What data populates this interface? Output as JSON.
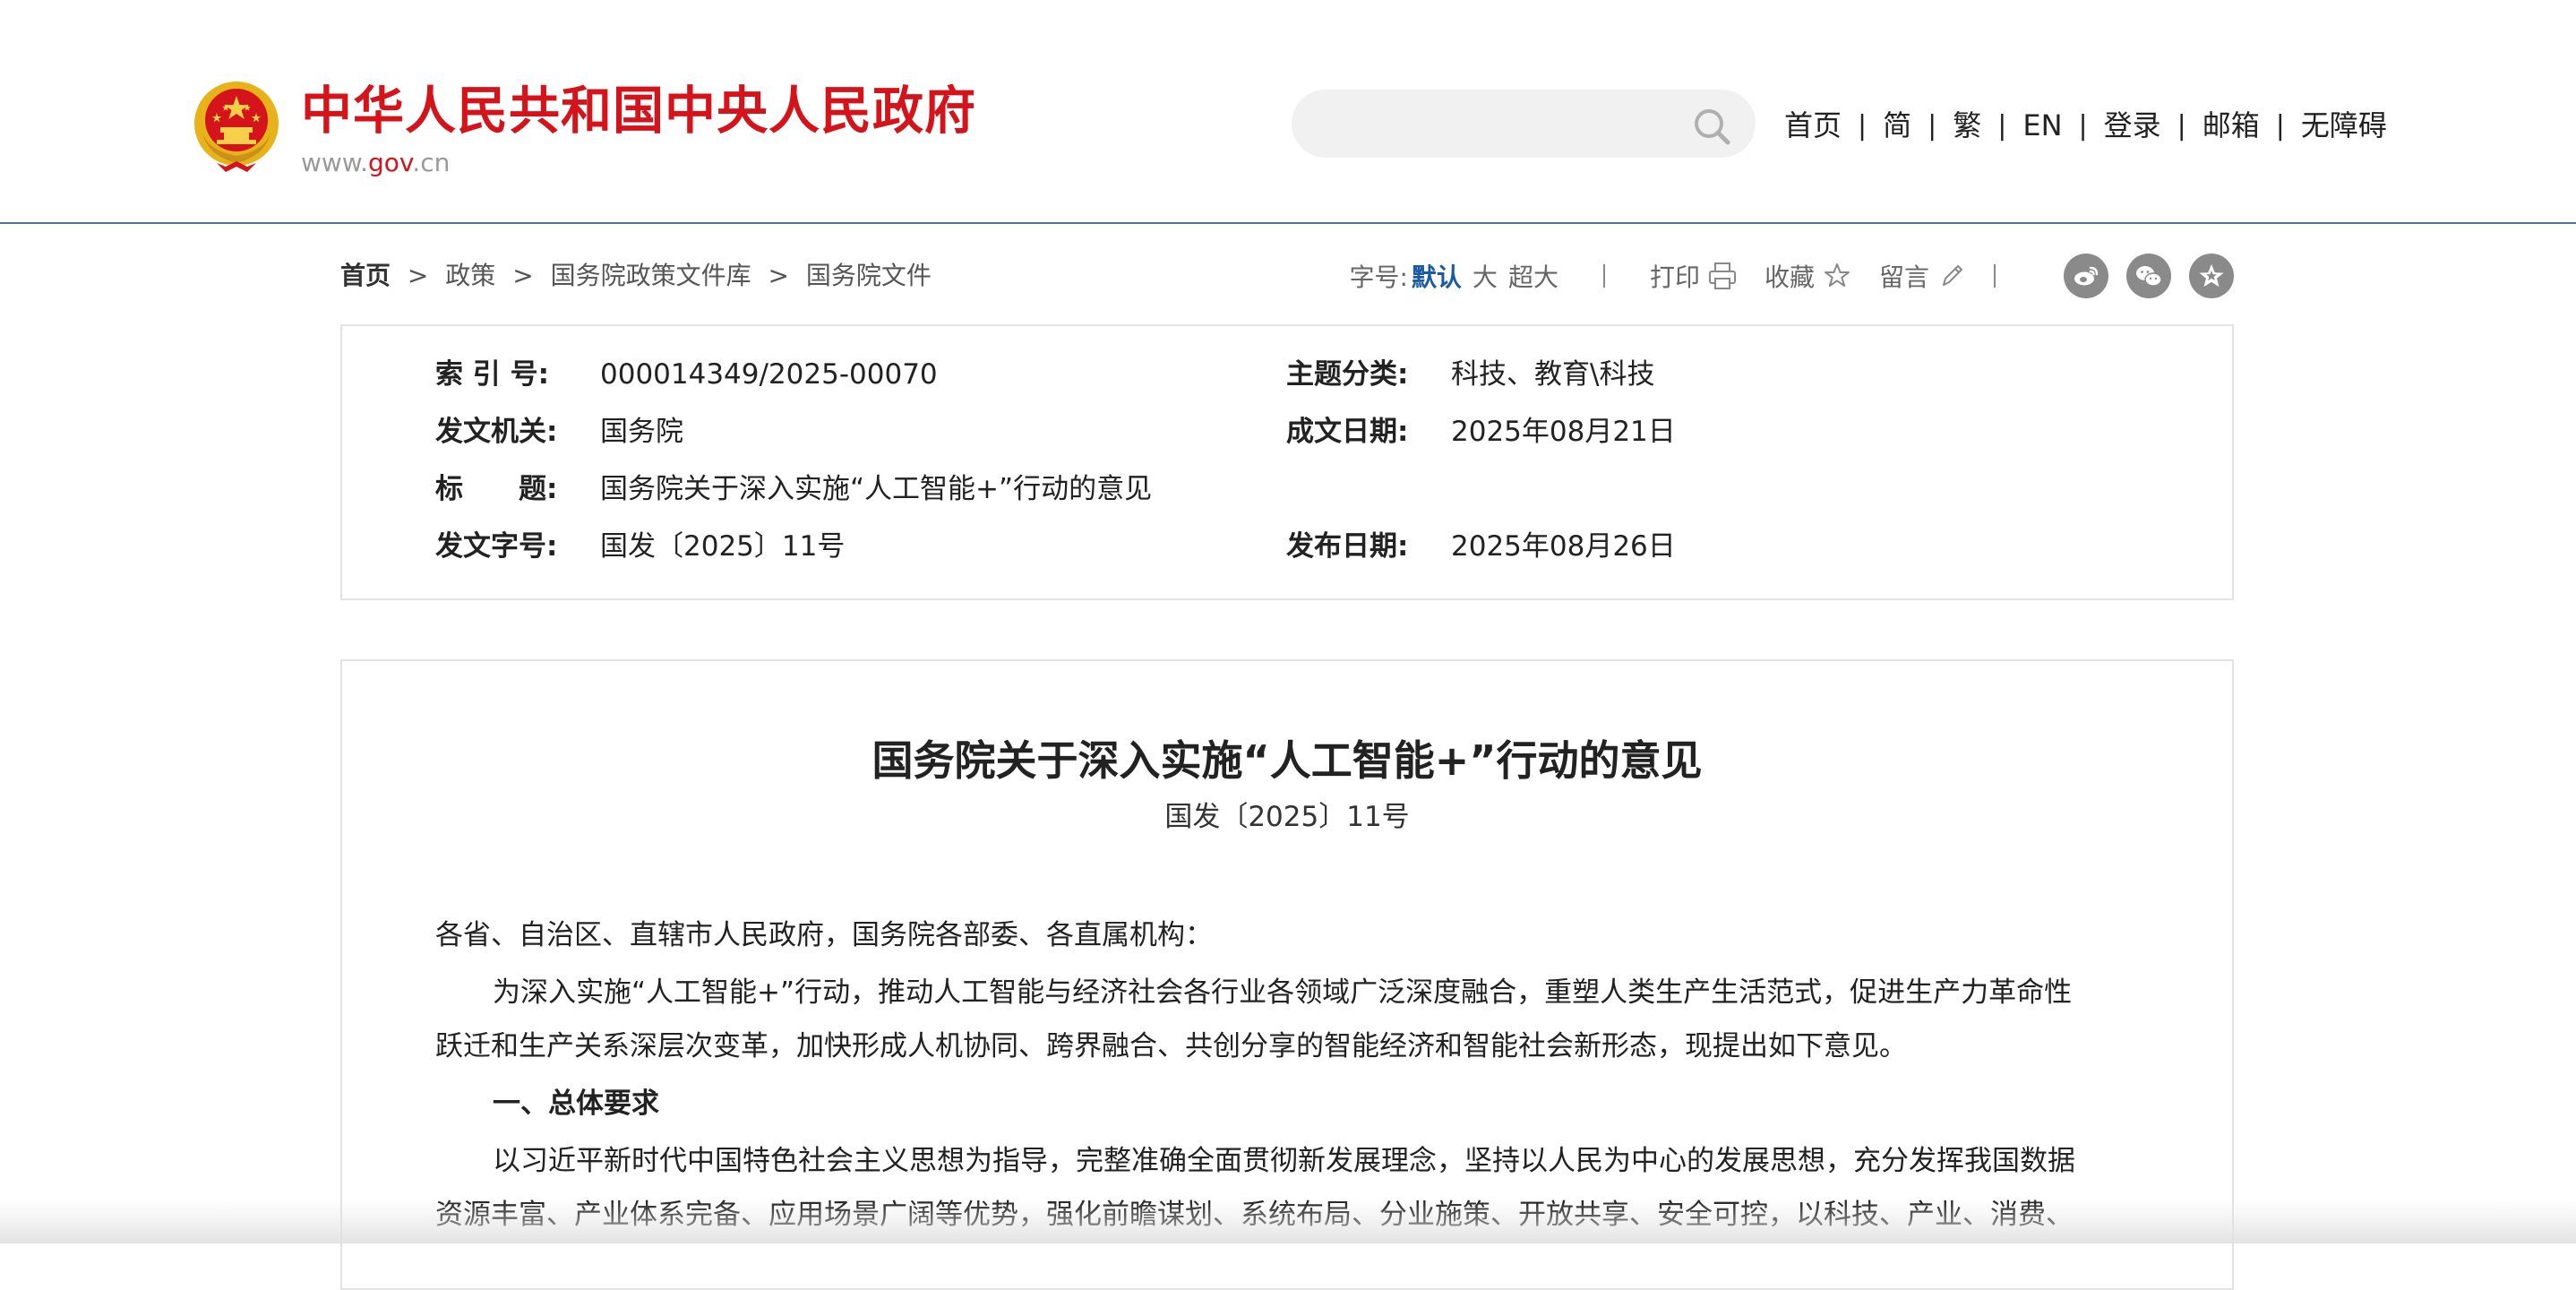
{
  "header": {
    "site_title": "中华人民共和国中央人民政府",
    "url_prefix": "www.",
    "url_gov": "gov",
    "url_suffix": ".cn",
    "brand_color": "#d4141a",
    "search": {
      "placeholder": "",
      "icon": "search-icon"
    },
    "nav": [
      "首页",
      "简",
      "繁",
      "EN",
      "登录",
      "邮箱",
      "无障碍"
    ],
    "nav_separator": "|"
  },
  "breadcrumb": {
    "items": [
      "首页",
      "政策",
      "国务院政策文件库",
      "国务院文件"
    ],
    "separator": ">"
  },
  "tools": {
    "font_size_label": "字号:",
    "font_size_options": [
      "默认",
      "大",
      "超大"
    ],
    "font_size_selected": "默认",
    "separator": "|",
    "print_label": "打印",
    "favorite_label": "收藏",
    "comment_label": "留言",
    "share_icons": [
      "weibo-icon",
      "wechat-icon",
      "qzone-icon"
    ]
  },
  "info": {
    "index_label": "索 引 号:",
    "index_value": "000014349/2025-00070",
    "category_label": "主题分类:",
    "category_value": "科技、教育\\科技",
    "issuer_label": "发文机关:",
    "issuer_value": "国务院",
    "written_date_label": "成文日期:",
    "written_date_value": "2025年08月21日",
    "title_label": "标　　题:",
    "title_value": "国务院关于深入实施“人工智能+”行动的意见",
    "doc_number_label": "发文字号:",
    "doc_number_value": "国发〔2025〕11号",
    "publish_date_label": "发布日期:",
    "publish_date_value": "2025年08月26日"
  },
  "article": {
    "title": "国务院关于深入实施“人工智能+”行动的意见",
    "doc_number": "国发〔2025〕11号",
    "salutation": "各省、自治区、直辖市人民政府，国务院各部委、各直属机构：",
    "para1_line1": "为深入实施“人工智能+”行动，推动人工智能与经济社会各行业各领域广泛深度融合，重塑人类生产生活范式，促进生产力革命性",
    "para1_line2": "跃迁和生产关系深层次变革，加快形成人机协同、跨界融合、共创分享的智能经济和智能社会新形态，现提出如下意见。",
    "section1_heading": "一、总体要求",
    "para2_line1": "以习近平新时代中国特色社会主义思想为指导，完整准确全面贯彻新发展理念，坚持以人民为中心的发展思想，充分发挥我国数据",
    "para2_line2": "资源丰富、产业体系完备、应用场景广阔等优势，强化前瞻谋划、系统布局、分业施策、开放共享、安全可控，以科技、产业、消费、"
  }
}
